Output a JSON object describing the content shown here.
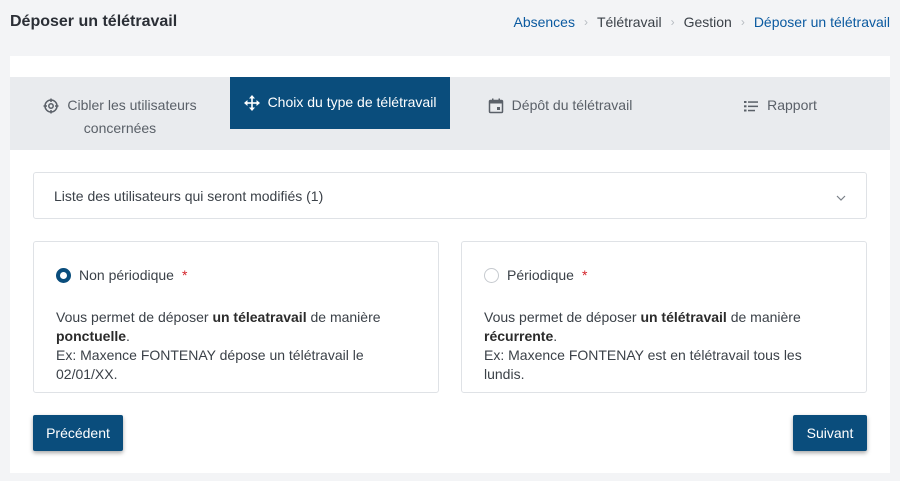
{
  "header": {
    "title": "Déposer un télétravail",
    "breadcrumb": [
      "Absences",
      "Télétravail",
      "Gestion",
      "Déposer un télétravail"
    ]
  },
  "steps": [
    {
      "label_line1": "Cibler les utilisateurs",
      "label_line2": "concernées",
      "icon": "target-icon",
      "active": false
    },
    {
      "label_line1": "Choix du type de télétravail",
      "label_line2": "",
      "icon": "move-arrows-icon",
      "active": true
    },
    {
      "label_line1": "Dépôt du télétravail",
      "label_line2": "",
      "icon": "calendar-icon",
      "active": false
    },
    {
      "label_line1": "Rapport",
      "label_line2": "",
      "icon": "list-icon",
      "active": false
    }
  ],
  "users_list": {
    "label": "Liste des utilisateurs qui seront modifiés",
    "count": "(1)"
  },
  "options": [
    {
      "label": "Non périodique",
      "required_mark": "*",
      "selected": true,
      "desc_prefix": "Vous permet de déposer ",
      "desc_bold1": "un téleatravail",
      "desc_mid": " de manière",
      "desc_bold2": "ponctuelle",
      "desc_end": ".",
      "example": "Ex: Maxence FONTENAY dépose un télétravail le 02/01/XX."
    },
    {
      "label": "Périodique",
      "required_mark": "*",
      "selected": false,
      "desc_prefix": "Vous permet de déposer ",
      "desc_bold1": "un télétravail",
      "desc_mid": " de manière",
      "desc_bold2": "récurrente",
      "desc_end": ".",
      "example": "Ex: Maxence FONTENAY est en télétravail tous les lundis."
    }
  ],
  "buttons": {
    "previous": "Précédent",
    "next": "Suivant"
  },
  "colors": {
    "primary": "#0a4d7c",
    "link": "#0b5aa0",
    "required": "#d4242b"
  }
}
